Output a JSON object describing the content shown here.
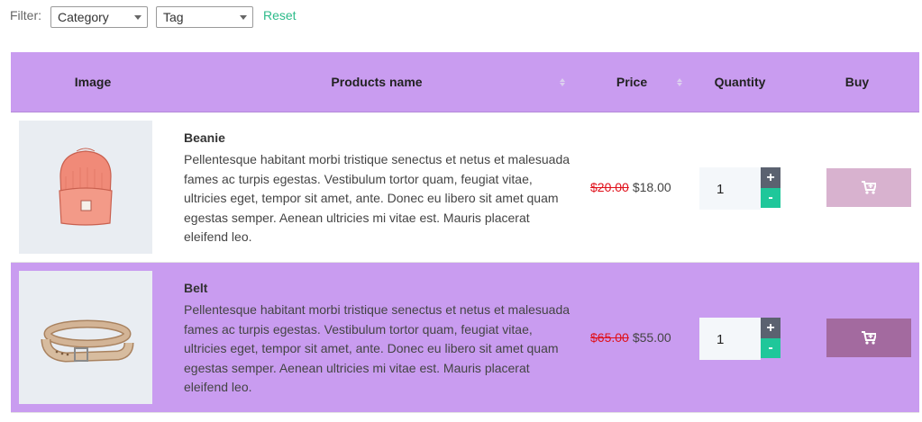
{
  "filter": {
    "label": "Filter:",
    "category_value": "Category",
    "tag_value": "Tag",
    "reset_label": "Reset"
  },
  "table": {
    "headers": {
      "image": "Image",
      "name": "Products name",
      "price": "Price",
      "quantity": "Quantity",
      "buy": "Buy"
    },
    "rows": [
      {
        "name": "Beanie",
        "description": "Pellentesque habitant morbi tristique senectus et netus et malesuada fames ac turpis egestas. Vestibulum tortor quam, feugiat vitae, ultricies eget, tempor sit amet, ante. Donec eu libero sit amet quam egestas semper. Aenean ultricies mi vitae est. Mauris placerat eleifend leo.",
        "old_price": "$20.00",
        "price": "$18.00",
        "quantity": "1",
        "image_icon": "beanie-image",
        "buy_icon": "cart-plus-icon"
      },
      {
        "name": "Belt",
        "description": "Pellentesque habitant morbi tristique senectus et netus et malesuada fames ac turpis egestas. Vestibulum tortor quam, feugiat vitae, ultricies eget, tempor sit amet, ante. Donec eu libero sit amet quam egestas semper. Aenean ultricies mi vitae est. Mauris placerat eleifend leo.",
        "old_price": "$65.00",
        "price": "$55.00",
        "quantity": "1",
        "image_icon": "belt-image",
        "buy_icon": "cart-plus-icon"
      }
    ],
    "qty_plus": "+",
    "qty_minus": "-"
  },
  "colors": {
    "header_bg": "#c99cf0",
    "reset_link": "#2dbb8a",
    "old_price": "#e0101a",
    "qty_minus_bg": "#1fc79a",
    "qty_plus_bg": "#5b6270",
    "buy_button_row1": "#d8b2cf",
    "buy_button_row2": "#a36a9f"
  }
}
